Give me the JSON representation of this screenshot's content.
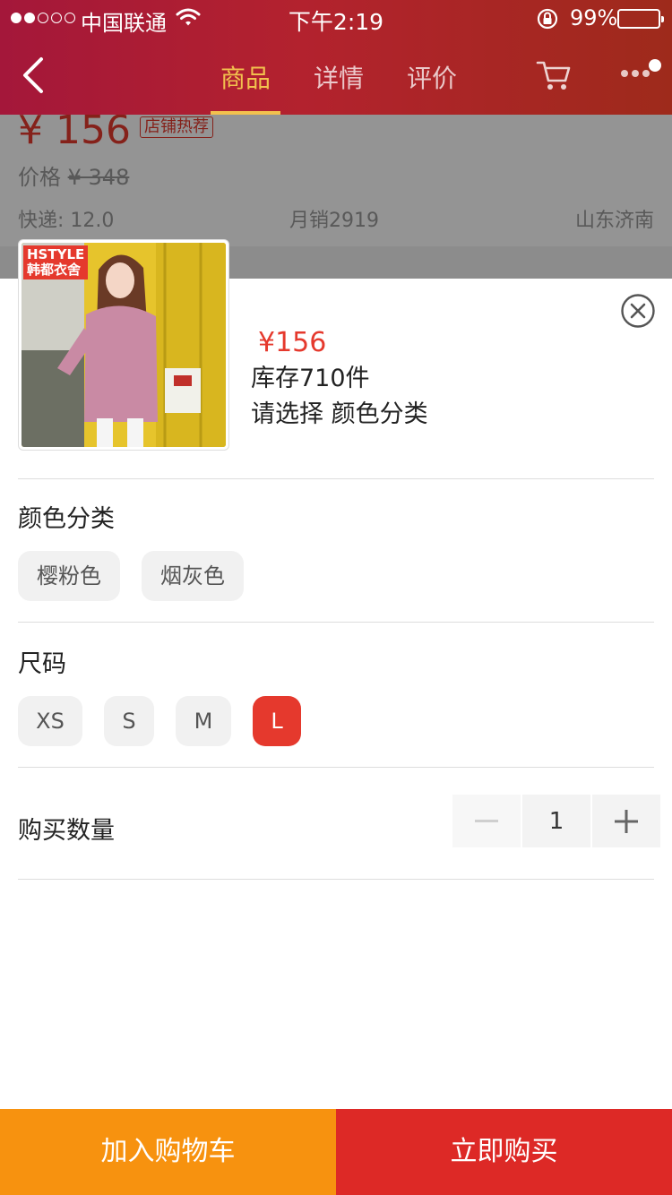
{
  "status_bar": {
    "carrier": "中国联通",
    "time": "下午2:19",
    "battery": "99%",
    "battery_level": 0.99,
    "signal_dots_filled": 2,
    "signal_dots_total": 5
  },
  "nav": {
    "tabs": [
      {
        "label": "商品",
        "active": true
      },
      {
        "label": "详情",
        "active": false
      },
      {
        "label": "评价",
        "active": false
      }
    ]
  },
  "product": {
    "price": "¥ 156",
    "price_badge": "店铺热荐",
    "original_price_label": "价格",
    "original_price": "¥ 348",
    "shipping": "快递: 12.0",
    "monthly_sales": "月销2919",
    "location": "山东济南"
  },
  "sheet": {
    "brand_en": "HSTYLE",
    "brand_cn": "韩都衣舍",
    "price": "¥156",
    "stock": "库存710件",
    "select_hint": "请选择 颜色分类",
    "color_section": {
      "title": "颜色分类",
      "options": [
        "樱粉色",
        "烟灰色"
      ]
    },
    "size_section": {
      "title": "尺码",
      "options": [
        "XS",
        "S",
        "M",
        "L"
      ],
      "selected": "L"
    },
    "quantity": {
      "label": "购买数量",
      "value": "1",
      "minus": "−",
      "plus": "+"
    }
  },
  "actions": {
    "add_to_cart": "加入购物车",
    "buy_now": "立即购买"
  },
  "colors": {
    "header_start": "#a4173a",
    "header_end": "#9e2a1b",
    "accent_gold": "#f2c14e",
    "price_red": "#e5392d",
    "cart_orange": "#f7920f",
    "buy_red": "#dd2926"
  }
}
